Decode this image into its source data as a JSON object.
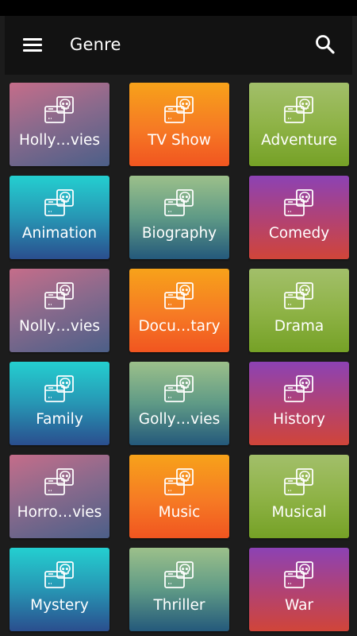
{
  "app": {
    "title": "Genre",
    "menu_icon": "hamburger-menu-icon",
    "search_icon": "search-icon"
  },
  "colors": {
    "appbar": "#121212",
    "background": "#1c1c1c",
    "text": "#ffffff"
  },
  "genres": [
    {
      "label": "Holly…vies",
      "style": "purple",
      "icon": "film-skull-icon"
    },
    {
      "label": "TV Show",
      "style": "orange",
      "icon": "film-skull-icon"
    },
    {
      "label": "Adventure",
      "style": "green",
      "icon": "film-skull-icon"
    },
    {
      "label": "Animation",
      "style": "teal",
      "icon": "film-skull-icon"
    },
    {
      "label": "Biography",
      "style": "sage",
      "icon": "film-skull-icon"
    },
    {
      "label": "Comedy",
      "style": "magenta",
      "icon": "film-skull-icon"
    },
    {
      "label": "Nolly…vies",
      "style": "purple",
      "icon": "film-skull-icon"
    },
    {
      "label": "Docu…tary",
      "style": "orange",
      "icon": "film-skull-icon"
    },
    {
      "label": "Drama",
      "style": "green",
      "icon": "film-skull-icon"
    },
    {
      "label": "Family",
      "style": "teal",
      "icon": "film-skull-icon"
    },
    {
      "label": "Golly…vies",
      "style": "sage",
      "icon": "film-skull-icon"
    },
    {
      "label": "History",
      "style": "magenta",
      "icon": "film-skull-icon"
    },
    {
      "label": "Horro…vies",
      "style": "purple",
      "icon": "film-skull-icon"
    },
    {
      "label": "Music",
      "style": "orange",
      "icon": "film-skull-icon"
    },
    {
      "label": "Musical",
      "style": "green",
      "icon": "film-skull-icon"
    },
    {
      "label": "Mystery",
      "style": "teal",
      "icon": "film-skull-icon"
    },
    {
      "label": "Thriller",
      "style": "sage",
      "icon": "film-skull-icon"
    },
    {
      "label": "War",
      "style": "magenta",
      "icon": "film-skull-icon"
    }
  ]
}
